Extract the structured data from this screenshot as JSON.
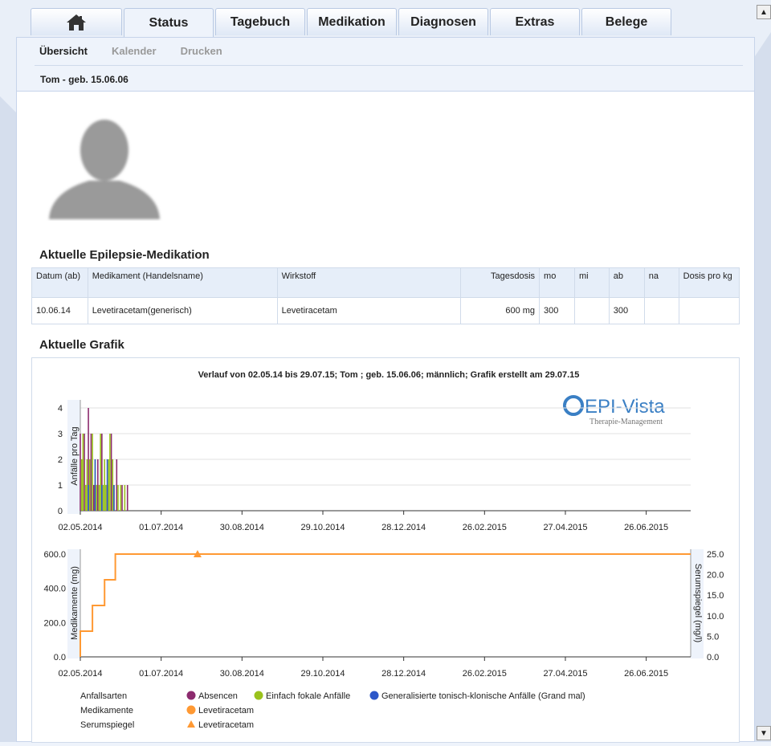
{
  "tabs": [
    {
      "label": "",
      "icon": "home-icon",
      "width": 114
    },
    {
      "label": "Status",
      "width": 112
    },
    {
      "label": "Tagebuch",
      "width": 112
    },
    {
      "label": "Medikation",
      "width": 112
    },
    {
      "label": "Diagnosen",
      "width": 112
    },
    {
      "label": "Extras",
      "width": 112
    },
    {
      "label": "Belege",
      "width": 112
    }
  ],
  "subtabs": [
    "Übersicht",
    "Kalender",
    "Drucken"
  ],
  "patient": "Tom - geb. 15.06.06",
  "medication": {
    "heading": "Aktuelle Epilepsie-Medikation",
    "columns": [
      "Datum (ab)",
      "Medikament (Handelsname)",
      "Wirkstoff",
      "Tagesdosis",
      "mo",
      "mi",
      "ab",
      "na",
      "Dosis pro kg"
    ],
    "rows": [
      [
        "10.06.14",
        "Levetiracetam(generisch)",
        "Levetiracetam",
        "600 mg",
        "300",
        "",
        "300",
        "",
        ""
      ]
    ]
  },
  "graphic_heading": "Aktuelle Grafik",
  "chart_data": [
    {
      "type": "bar",
      "title": "Verlauf von 02.05.14 bis 29.07.15;   Tom ; geb. 15.06.06; männlich; Grafik erstellt am 29.07.15",
      "ylabel": "Anfälle pro Tag",
      "ylim": [
        0,
        4
      ],
      "yticks": [
        0,
        1,
        2,
        3,
        4
      ],
      "xticks": [
        "02.05.2014",
        "01.07.2014",
        "30.08.2014",
        "29.10.2014",
        "28.12.2014",
        "26.02.2015",
        "27.04.2015",
        "26.06.2015"
      ],
      "logo": {
        "name": "EPI-Vista",
        "tagline": "Therapie-Management"
      },
      "series": [
        {
          "name": "Absencen",
          "color": "#8c2b6e",
          "points": [
            [
              0,
              3
            ],
            [
              3,
              3
            ],
            [
              6,
              4
            ],
            [
              8,
              3
            ],
            [
              10,
              1
            ],
            [
              13,
              2
            ],
            [
              16,
              3
            ],
            [
              20,
              1
            ],
            [
              23,
              3
            ],
            [
              27,
              2
            ],
            [
              31,
              1
            ],
            [
              35,
              1
            ]
          ]
        },
        {
          "name": "Einfach fokale Anfälle",
          "color": "#9ac21d",
          "points": [
            [
              1,
              2
            ],
            [
              2,
              3
            ],
            [
              4,
              1
            ],
            [
              5,
              2
            ],
            [
              7,
              2
            ],
            [
              9,
              3
            ],
            [
              11,
              2
            ],
            [
              12,
              1
            ],
            [
              14,
              1
            ],
            [
              15,
              3
            ],
            [
              17,
              1
            ],
            [
              18,
              2
            ],
            [
              19,
              1
            ],
            [
              21,
              2
            ],
            [
              22,
              3
            ],
            [
              24,
              2
            ],
            [
              25,
              1
            ],
            [
              28,
              1
            ],
            [
              30,
              1
            ],
            [
              33,
              1
            ]
          ]
        },
        {
          "name": "Generalisierte tonisch-klonische Anfälle (Grand mal)",
          "color": "#2d57c9",
          "points": [
            [
              6,
              1
            ],
            [
              11,
              2
            ],
            [
              16,
              1
            ],
            [
              20,
              2
            ],
            [
              25,
              1
            ]
          ]
        }
      ]
    },
    {
      "type": "line",
      "ylabel": "Medikamente (mg)",
      "y2label": "Serumspiegel (mg/l)",
      "ylim": [
        0,
        600
      ],
      "yticks": [
        "0.0",
        "200.0",
        "400.0",
        "600.0"
      ],
      "y2lim": [
        0,
        25
      ],
      "y2ticks": [
        "0.0",
        "5.0",
        "10.0",
        "15.0",
        "20.0",
        "25.0"
      ],
      "xticks": [
        "02.05.2014",
        "01.07.2014",
        "30.08.2014",
        "29.10.2014",
        "28.12.2014",
        "26.02.2015",
        "27.04.2015",
        "26.06.2015"
      ],
      "series": [
        {
          "name": "Levetiracetam",
          "kind": "Medikamente",
          "color": "#ff9933",
          "steps": [
            [
              0,
              0
            ],
            [
              0,
              150
            ],
            [
              9,
              150
            ],
            [
              9,
              300
            ],
            [
              18,
              300
            ],
            [
              18,
              450
            ],
            [
              26,
              450
            ],
            [
              26,
              600
            ],
            [
              453,
              600
            ]
          ]
        },
        {
          "name": "Levetiracetam",
          "kind": "Serumspiegel",
          "color": "#ff9933",
          "marker": "triangle",
          "points": [
            [
              87,
              25
            ]
          ]
        }
      ]
    }
  ],
  "legend": {
    "rows": [
      {
        "label": "Anfallsarten",
        "items": [
          {
            "text": "Absencen",
            "color": "#8c2b6e",
            "shape": "circle"
          },
          {
            "text": "Einfach fokale Anfälle",
            "color": "#9ac21d",
            "shape": "circle"
          },
          {
            "text": "Generalisierte tonisch-klonische Anfälle (Grand mal)",
            "color": "#2d57c9",
            "shape": "circle"
          }
        ]
      },
      {
        "label": "Medikamente",
        "items": [
          {
            "text": "Levetiracetam",
            "color": "#ff9933",
            "shape": "circle"
          }
        ]
      },
      {
        "label": "Serumspiegel",
        "items": [
          {
            "text": "Levetiracetam",
            "color": "#ff9933",
            "shape": "triangle"
          }
        ]
      }
    ]
  },
  "colors": {
    "accent": "#3a7fc4",
    "tab_border": "#b9c9e3",
    "panel_bg": "#eef3fb"
  }
}
